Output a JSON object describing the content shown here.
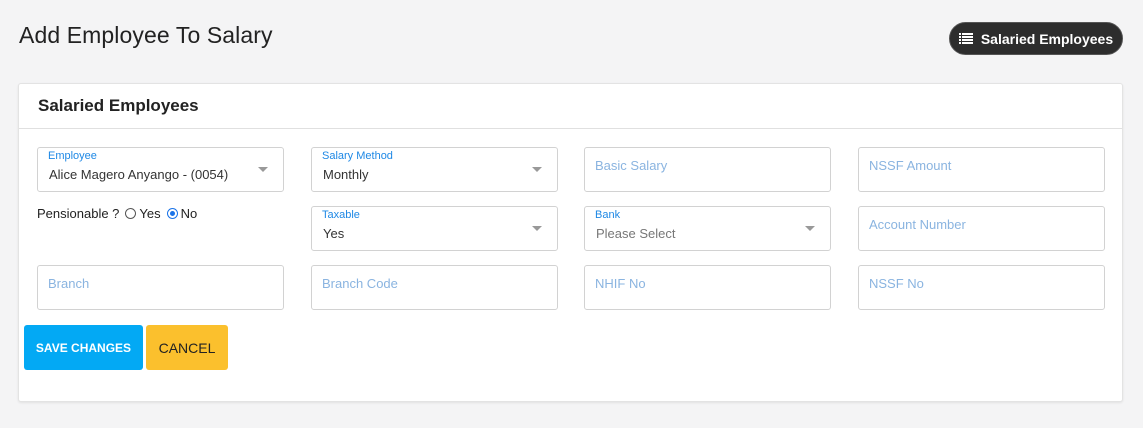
{
  "page": {
    "title": "Add Employee To Salary"
  },
  "toolbar": {
    "salaried_employees_label": "Salaried Employees",
    "icon": "list-icon"
  },
  "card": {
    "title": "Salaried Employees"
  },
  "form": {
    "employee": {
      "label": "Employee",
      "value": "Alice Magero Anyango - (0054)"
    },
    "salary_method": {
      "label": "Salary Method",
      "value": "Monthly"
    },
    "basic_salary": {
      "placeholder": "Basic Salary"
    },
    "nssf_amount": {
      "placeholder": "NSSF Amount"
    },
    "pensionable": {
      "label": "Pensionable ?",
      "options": [
        "Yes",
        "No"
      ],
      "selected": "No"
    },
    "taxable": {
      "label": "Taxable",
      "value": "Yes"
    },
    "bank": {
      "label": "Bank",
      "value": "Please Select"
    },
    "account_number": {
      "placeholder": "Account Number"
    },
    "branch": {
      "placeholder": "Branch"
    },
    "branch_code": {
      "placeholder": "Branch Code"
    },
    "nhif_no": {
      "placeholder": "NHIF No"
    },
    "nssf_no": {
      "placeholder": "NSSF No"
    }
  },
  "actions": {
    "save_label": "SAVE CHANGES",
    "cancel_label": "CANCEL"
  },
  "colors": {
    "primary": "#03a9f4",
    "warning": "#fbc02d",
    "dark": "#2d2d2d",
    "label_blue": "#1e88e5"
  }
}
